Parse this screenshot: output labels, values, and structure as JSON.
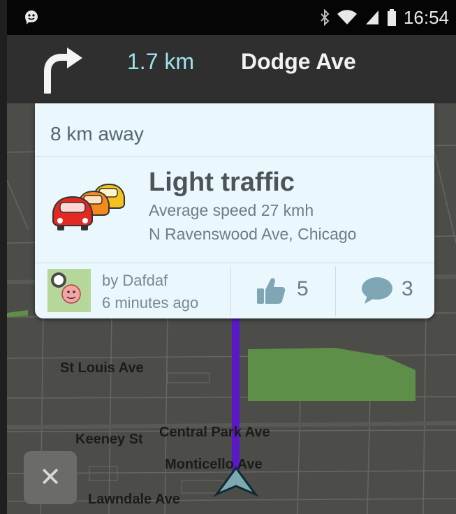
{
  "status_bar": {
    "time": "16:54",
    "icons": [
      "waze-icon",
      "bluetooth-icon",
      "wifi-icon",
      "signal-icon",
      "battery-icon"
    ]
  },
  "navigation": {
    "turn_direction": "turn-right-icon",
    "distance": "1.7 km",
    "street": "Dodge Ave"
  },
  "map": {
    "labels": [
      "St Louis Ave",
      "Keeney St",
      "Central Park Ave",
      "Monticello Ave",
      "Lawndale Ave"
    ],
    "close_icon": "close-icon",
    "colors": {
      "route": "#5a18c9",
      "park": "#5e8f48",
      "map_bg": "#4c4c48"
    }
  },
  "report": {
    "distance_away": "8 km away",
    "title": "Light traffic",
    "speed": "Average speed 27 kmh",
    "location": "N Ravenswood Ave, Chicago",
    "reporter": "by Dafdaf",
    "time_ago": "6 minutes ago",
    "thumbs_up": "5",
    "comments": "3"
  }
}
